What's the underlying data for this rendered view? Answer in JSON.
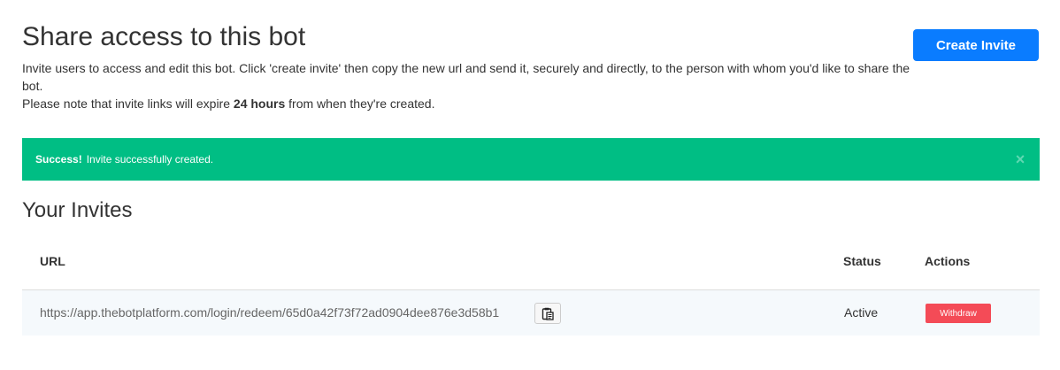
{
  "header": {
    "title": "Share access to this bot",
    "intro_line1": "Invite users to access and edit this bot. Click 'create invite' then copy the new url and send it, securely and directly, to the person with whom you'd like to share the bot.",
    "intro_line2_prefix": "Please note that invite links will expire ",
    "intro_line2_bold": "24 hours",
    "intro_line2_suffix": " from when they're created.",
    "create_button_label": "Create Invite"
  },
  "alert": {
    "strong_text": "Success!",
    "message": "Invite successfully created.",
    "close_glyph": "×",
    "color": "#00be84"
  },
  "invites": {
    "title": "Your Invites",
    "columns": [
      "URL",
      "Status",
      "Actions"
    ],
    "rows": [
      {
        "url": "https://app.thebotplatform.com/login/redeem/65d0a42f73f72ad0904dee876e3d58b1",
        "copy_icon": "clipboard-icon",
        "status": "Active",
        "action_label": "Withdraw"
      }
    ]
  },
  "colors": {
    "primary": "#0a7cff",
    "success": "#00be84",
    "danger": "#f44b57"
  }
}
